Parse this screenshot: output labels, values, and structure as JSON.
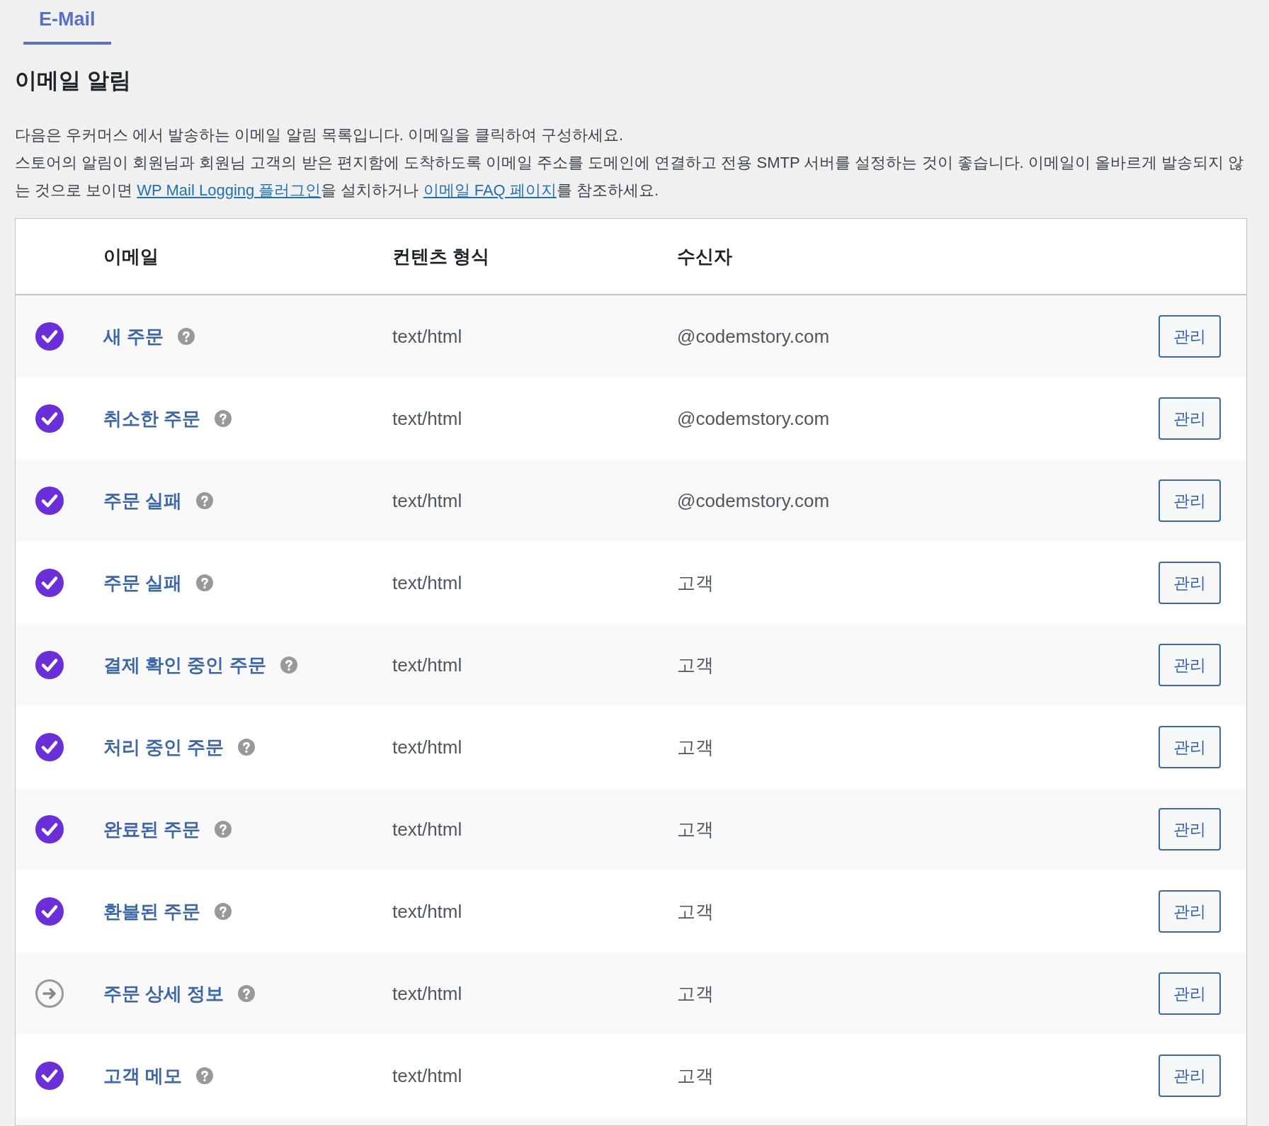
{
  "tabs": [
    {
      "label": "E-Mail",
      "selected": true
    }
  ],
  "heading": "이메일 알림",
  "intro": "다음은 우커머스 에서 발송하는 이메일 알림 목록입니다. 이메일을 클릭하여 구성하세요.",
  "note": {
    "before": "스토어의 알림이 회원님과 회원님 고객의 받은 편지함에 도착하도록 이메일 주소를 도메인에 연결하고 전용 SMTP 서버를 설정하는 것이 좋습니다. 이메일이 올바르게 발송되지 않는 것으로 보이면 ",
    "link1": "WP Mail Logging 플러그인",
    "middle": "을 설치하거나 ",
    "link2": "이메일 FAQ 페이지",
    "after": "를 참조하세요."
  },
  "table": {
    "columns": [
      "이메일",
      "컨텐츠 형식",
      "수신자"
    ],
    "rows": [
      {
        "enabled": true,
        "name": "새 주문",
        "type": "text/html",
        "recipient": "@codemstory.com",
        "action": "관리"
      },
      {
        "enabled": true,
        "name": "취소한 주문",
        "type": "text/html",
        "recipient": "@codemstory.com",
        "action": "관리"
      },
      {
        "enabled": true,
        "name": "주문 실패",
        "type": "text/html",
        "recipient": "@codemstory.com",
        "action": "관리"
      },
      {
        "enabled": true,
        "name": "주문 실패",
        "type": "text/html",
        "recipient": "고객",
        "action": "관리"
      },
      {
        "enabled": true,
        "name": "결제 확인 중인 주문",
        "type": "text/html",
        "recipient": "고객",
        "action": "관리"
      },
      {
        "enabled": true,
        "name": "처리 중인 주문",
        "type": "text/html",
        "recipient": "고객",
        "action": "관리"
      },
      {
        "enabled": true,
        "name": "완료된 주문",
        "type": "text/html",
        "recipient": "고객",
        "action": "관리"
      },
      {
        "enabled": true,
        "name": "환불된 주문",
        "type": "text/html",
        "recipient": "고객",
        "action": "관리"
      },
      {
        "enabled": false,
        "name": "주문 상세 정보",
        "type": "text/html",
        "recipient": "고객",
        "action": "관리"
      },
      {
        "enabled": true,
        "name": "고객 메모",
        "type": "text/html",
        "recipient": "고객",
        "action": "관리"
      }
    ]
  }
}
